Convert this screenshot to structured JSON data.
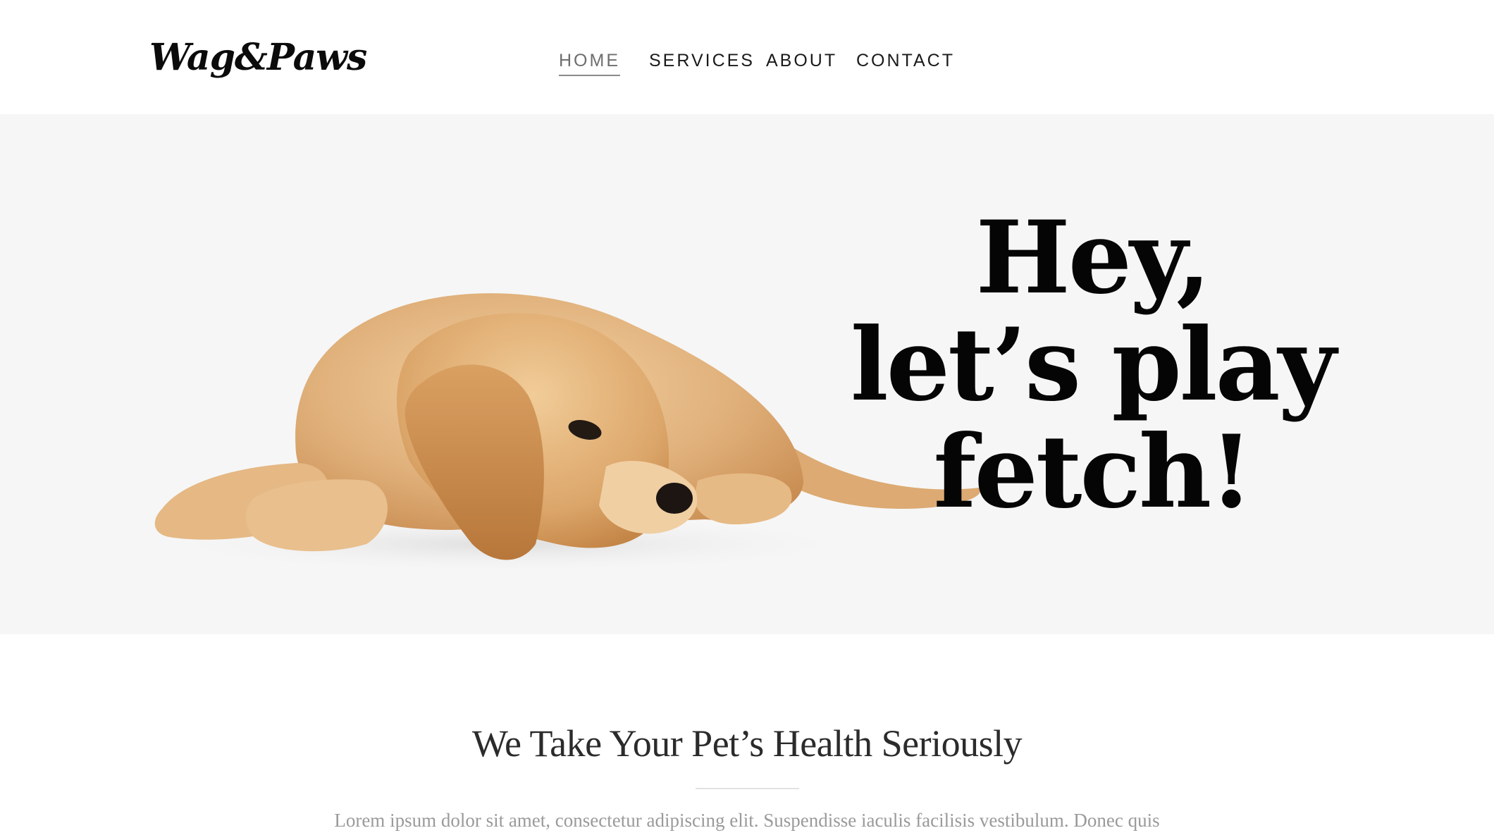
{
  "header": {
    "logo_text": "Wag&Paws",
    "nav": {
      "home": "HOME",
      "services": "SERVICES",
      "about": "ABOUT",
      "contact": "CONTACT",
      "active": "HOME"
    }
  },
  "hero": {
    "heading_line_1": "Hey,",
    "heading_line_2": "let’s play",
    "heading_line_3": "fetch!",
    "image": "golden-retriever-puppy-lying-down",
    "background_color": "#f6f6f6"
  },
  "intro": {
    "title": "We Take Your Pet’s Health Seriously",
    "text": "Lorem ipsum dolor sit amet, consectetur adipiscing elit. Suspendisse iaculis facilisis vestibulum. Donec quis"
  },
  "colors": {
    "text_primary": "#111111",
    "nav_active": "#6e6e6e",
    "body_text": "#9a9a9a",
    "puppy_fur": "#d9a56c"
  }
}
